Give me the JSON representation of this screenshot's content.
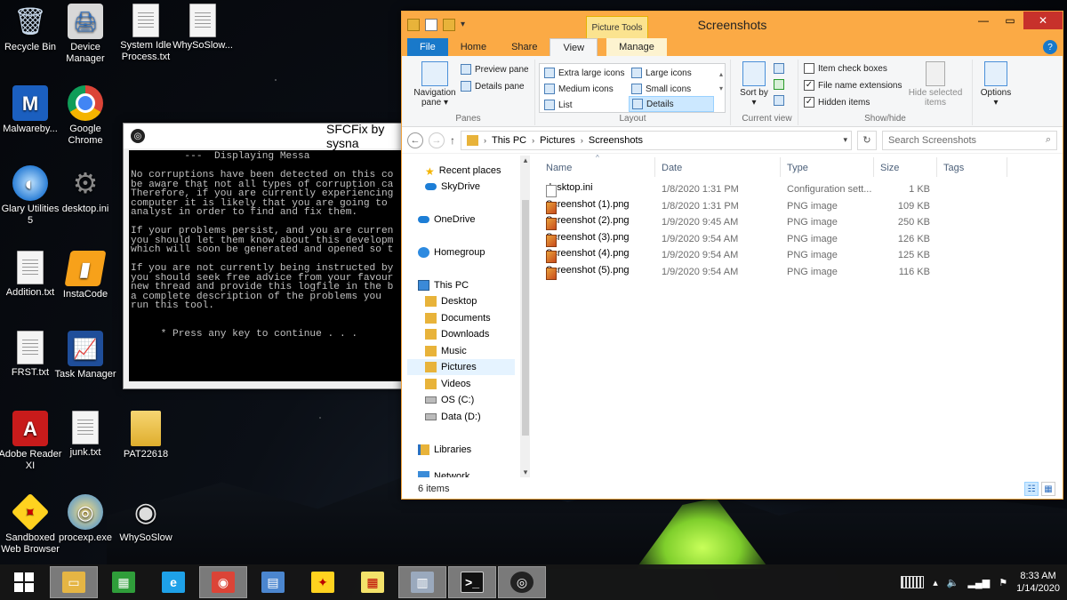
{
  "desktop": {
    "icons": [
      {
        "label": "Recycle Bin",
        "icon": "recycle-bin-icon",
        "glyph": "🗑"
      },
      {
        "label": "Device Manager",
        "icon": "device-manager-icon",
        "glyph": "🖨"
      },
      {
        "label": "System Idle Process.txt",
        "icon": "text-file-icon",
        "glyph": ""
      },
      {
        "label": "WhySoSlow...",
        "icon": "text-file-icon",
        "glyph": ""
      },
      {
        "label": "Malwareby...",
        "icon": "malwarebytes-icon",
        "glyph": "M"
      },
      {
        "label": "Google Chrome",
        "icon": "chrome-icon",
        "glyph": ""
      },
      {
        "label": "Glary Utilities 5",
        "icon": "glary-utilities-icon",
        "glyph": "◐"
      },
      {
        "label": "desktop.ini",
        "icon": "settings-file-icon",
        "glyph": "⚙"
      },
      {
        "label": "Addition.txt",
        "icon": "text-file-icon",
        "glyph": ""
      },
      {
        "label": "InstaCode",
        "icon": "instacode-icon",
        "glyph": "▮"
      },
      {
        "label": "FRST.txt",
        "icon": "text-file-icon",
        "glyph": ""
      },
      {
        "label": "Task Manager",
        "icon": "task-manager-icon",
        "glyph": "📈"
      },
      {
        "label": "Adobe Reader XI",
        "icon": "adobe-reader-icon",
        "glyph": "A"
      },
      {
        "label": "junk.txt",
        "icon": "text-file-icon",
        "glyph": ""
      },
      {
        "label": "PAT22618",
        "icon": "folder-icon",
        "glyph": ""
      },
      {
        "label": "Sandboxed Web Browser",
        "icon": "sandboxie-icon",
        "glyph": "✦"
      },
      {
        "label": "procexp.exe",
        "icon": "process-explorer-icon",
        "glyph": "◎"
      },
      {
        "label": "WhySoSlow",
        "icon": "whysoslow-icon",
        "glyph": "◉"
      }
    ]
  },
  "console": {
    "title": "SFCFix by sysna",
    "lines": [
      "         ---  Displaying Messa",
      "",
      "No corruptions have been detected on this co",
      "be aware that not all types of corruption ca",
      "Therefore, if you are currently experiencing",
      "computer it is likely that you are going to ",
      "analyst in order to find and fix them.",
      "",
      "If your problems persist, and you are curren",
      "you should let them know about this developm",
      "which will soon be generated and opened so t",
      "",
      "If you are not currently being instructed by",
      "you should seek free advice from your favour",
      "new thread and provide this logfile in the b",
      "a complete description of the problems you ",
      "run this tool.",
      "",
      "",
      "     * Press any key to continue . . ."
    ]
  },
  "explorer": {
    "title": "Screenshots",
    "picture_tools": "Picture Tools",
    "tabs": [
      "File",
      "Home",
      "Share",
      "View",
      "Manage"
    ],
    "help": "?",
    "ribbon": {
      "navigation_pane": "Navigation pane",
      "preview_pane": "Preview pane",
      "details_pane": "Details pane",
      "panes_label": "Panes",
      "layout_items": [
        "Extra large icons",
        "Large icons",
        "Medium icons",
        "Small icons",
        "List",
        "Details"
      ],
      "layout_label": "Layout",
      "sort_by": "Sort by",
      "current_view_label": "Current view",
      "item_check_boxes": "Item check boxes",
      "file_name_extensions": "File name extensions",
      "hidden_items": "Hidden items",
      "hide_selected": "Hide selected items",
      "show_hide_label": "Show/hide",
      "options": "Options"
    },
    "breadcrumb": [
      "This PC",
      "Pictures",
      "Screenshots"
    ],
    "search_placeholder": "Search Screenshots",
    "nav": [
      {
        "label": "Recent places",
        "icon": "recent-places-icon"
      },
      {
        "label": "SkyDrive",
        "icon": "skydrive-icon"
      },
      {
        "label": "OneDrive",
        "icon": "onedrive-icon"
      },
      {
        "label": "Homegroup",
        "icon": "homegroup-icon"
      },
      {
        "label": "This PC",
        "icon": "this-pc-icon"
      },
      {
        "label": "Desktop",
        "icon": "folder-icon"
      },
      {
        "label": "Documents",
        "icon": "folder-icon"
      },
      {
        "label": "Downloads",
        "icon": "folder-icon"
      },
      {
        "label": "Music",
        "icon": "folder-icon"
      },
      {
        "label": "Pictures",
        "icon": "folder-icon"
      },
      {
        "label": "Videos",
        "icon": "folder-icon"
      },
      {
        "label": "OS (C:)",
        "icon": "drive-icon"
      },
      {
        "label": "Data (D:)",
        "icon": "drive-icon"
      },
      {
        "label": "Libraries",
        "icon": "libraries-icon"
      },
      {
        "label": "Network",
        "icon": "network-icon"
      }
    ],
    "columns": [
      "Name",
      "Date",
      "Type",
      "Size",
      "Tags"
    ],
    "files": [
      {
        "name": "desktop.ini",
        "date": "1/8/2020 1:31 PM",
        "type": "Configuration sett...",
        "size": "1 KB",
        "kind": "ini"
      },
      {
        "name": "Screenshot (1).png",
        "date": "1/8/2020 1:31 PM",
        "type": "PNG image",
        "size": "109 KB",
        "kind": "png"
      },
      {
        "name": "Screenshot (2).png",
        "date": "1/9/2020 9:45 AM",
        "type": "PNG image",
        "size": "250 KB",
        "kind": "png"
      },
      {
        "name": "Screenshot (3).png",
        "date": "1/9/2020 9:54 AM",
        "type": "PNG image",
        "size": "126 KB",
        "kind": "png"
      },
      {
        "name": "Screenshot (4).png",
        "date": "1/9/2020 9:54 AM",
        "type": "PNG image",
        "size": "125 KB",
        "kind": "png"
      },
      {
        "name": "Screenshot (5).png",
        "date": "1/9/2020 9:54 AM",
        "type": "PNG image",
        "size": "116 KB",
        "kind": "png"
      }
    ],
    "status": "6 items"
  },
  "taskbar": {
    "items": [
      {
        "icon": "start-button-icon",
        "glyph": ""
      },
      {
        "icon": "file-explorer-icon",
        "glyph": "▭"
      },
      {
        "icon": "store-icon",
        "glyph": "▦"
      },
      {
        "icon": "internet-explorer-icon",
        "glyph": "e"
      },
      {
        "icon": "chrome-icon",
        "glyph": "◉"
      },
      {
        "icon": "control-panel-icon",
        "glyph": "▤"
      },
      {
        "icon": "sandboxie-icon",
        "glyph": "✦"
      },
      {
        "icon": "calculator-icon",
        "glyph": "▦"
      },
      {
        "icon": "task-manager-icon",
        "glyph": "▥"
      },
      {
        "icon": "command-prompt-icon",
        "glyph": ">_"
      },
      {
        "icon": "sfcfix-icon",
        "glyph": "◎"
      }
    ],
    "time": "8:33 AM",
    "date": "1/14/2020"
  }
}
